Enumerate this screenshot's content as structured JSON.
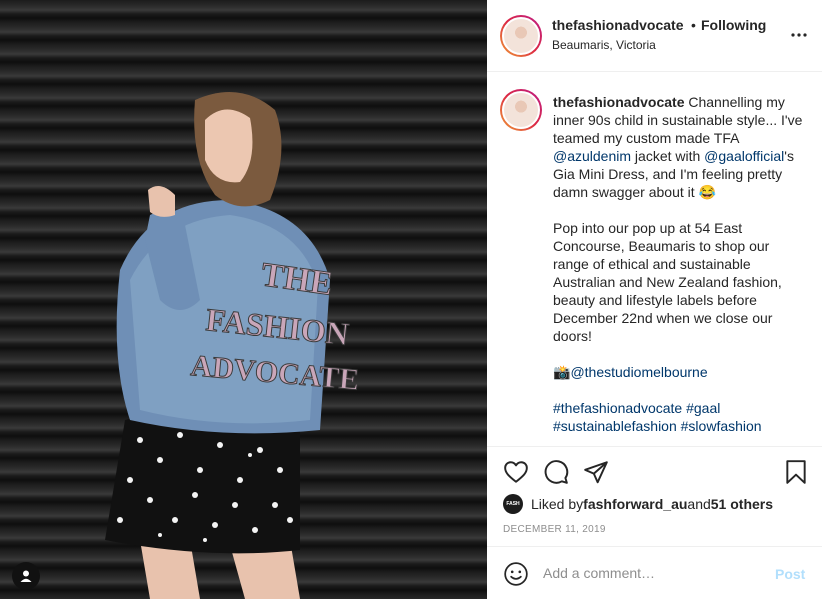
{
  "post": {
    "username": "thefashionadvocate",
    "separator": "•",
    "follow_status": "Following",
    "location": "Beaumaris, Victoria",
    "more_icon": "ellipsis-icon"
  },
  "caption": {
    "username": "thefashionadvocate",
    "text_1": " Channelling my inner 90s child in sustainable style... I've teamed my custom made TFA ",
    "mention_1": "@azuldenim",
    "text_2": " jacket with ",
    "mention_2": "@gaalofficial",
    "text_3": "'s Gia Mini Dress, and I'm feeling pretty damn swagger about it 😂\n\nPop into our pop up at 54 East Concourse, Beaumaris to shop our range of ethical and sustainable Australian and New Zealand fashion, beauty and lifestyle labels before December 22nd when we close our doors!\n\n📸",
    "mention_3": "@thestudiomelbourne",
    "text_4": "\n\n",
    "hashtag_1": "#thefashionadvocate",
    "text_5": " ",
    "hashtag_2": "#gaal",
    "text_6": "\n",
    "hashtag_3": "#sustainablefashion #slowfashion"
  },
  "photo": {
    "jacket_text": [
      "THE",
      "FASHION",
      "ADVOCATE"
    ]
  },
  "actions": {
    "icons": [
      "heart-icon",
      "comment-icon",
      "share-icon",
      "bookmark-icon"
    ]
  },
  "likes": {
    "prefix": "Liked by ",
    "liker": "fashforward_au",
    "connector": " and ",
    "others": "51 others",
    "liker_avatar_text": "FASH"
  },
  "date": "DECEMBER 11, 2019",
  "comment": {
    "placeholder": "Add a comment…",
    "post_label": "Post"
  },
  "colors": {
    "link": "#00376b",
    "post_disabled": "#b2dffc",
    "muted": "#8e8e8e",
    "border": "#efefef"
  }
}
